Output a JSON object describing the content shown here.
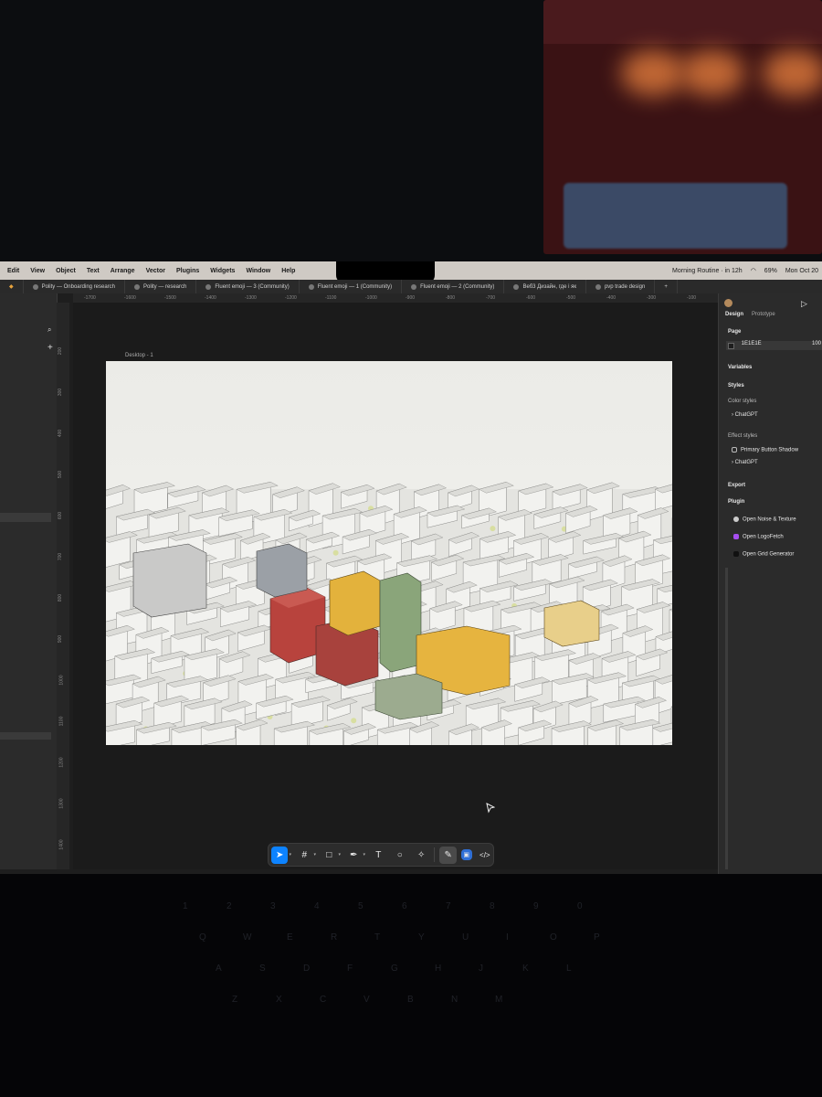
{
  "menubar": {
    "items": [
      "Edit",
      "View",
      "Object",
      "Text",
      "Arrange",
      "Vector",
      "Plugins",
      "Widgets",
      "Window",
      "Help"
    ],
    "routine": "Morning Routine · in 12h",
    "battery": "69%",
    "date": "Mon Oct 20"
  },
  "tabs": [
    "Polity — Onboarding research",
    "Polity — research",
    "Fluent emoji — 3 (Community)",
    "Fluent emoji — 1 (Community)",
    "Fluent emoji — 2 (Community)",
    "Веб3 Дизайн, где і як",
    "pvp trade design"
  ],
  "rulers": {
    "top": [
      "-1700",
      "-1600",
      "-1500",
      "-1400",
      "-1300",
      "-1200",
      "-1100",
      "-1000",
      "-900",
      "-800",
      "-700",
      "-600",
      "-500",
      "-400",
      "-300",
      "-100"
    ],
    "left": [
      "200",
      "300",
      "400",
      "500",
      "600",
      "700",
      "800",
      "900",
      "1000",
      "1100",
      "1200",
      "1300",
      "1400"
    ]
  },
  "canvas": {
    "frame_label": "Desktop - 1"
  },
  "right_panel": {
    "tabs": {
      "design": "Design",
      "prototype": "Prototype"
    },
    "page_label": "Page",
    "page_color": "1E1E1E",
    "page_opacity": "100",
    "variables": "Variables",
    "styles": "Styles",
    "color_styles": "Color styles",
    "color_style_item": "ChatGPT",
    "effect_styles": "Effect styles",
    "effect_style_items": [
      "Primary Button Shadow",
      "ChatGPT"
    ],
    "export": "Export",
    "plugin": "Plugin",
    "plugins": [
      "Open Noise & Texture",
      "Open LogoFetch",
      "Open Grid Generator"
    ]
  },
  "colors": {
    "accent": "#0d83ff",
    "panel": "#2b2b2b",
    "canvas": "#1b1b1b",
    "building_red": "#b8433d",
    "building_yellow": "#e3b23c",
    "building_green": "#8aa57a"
  },
  "toolbar": {
    "tools": [
      "move-icon",
      "frame-icon",
      "shape-icon",
      "pen-icon",
      "text-icon",
      "comment-icon",
      "actions-icon",
      "dev-mode-icon",
      "code-icon"
    ],
    "text_glyph": "T"
  },
  "keyboard_rows": [
    [
      "1",
      "2",
      "3",
      "4",
      "5",
      "6",
      "7",
      "8",
      "9",
      "0"
    ],
    [
      "Q",
      "W",
      "E",
      "R",
      "T",
      "Y",
      "U",
      "I",
      "O",
      "P"
    ],
    [
      "A",
      "S",
      "D",
      "F",
      "G",
      "H",
      "J",
      "K",
      "L"
    ],
    [
      "Z",
      "X",
      "C",
      "V",
      "B",
      "N",
      "M"
    ]
  ]
}
